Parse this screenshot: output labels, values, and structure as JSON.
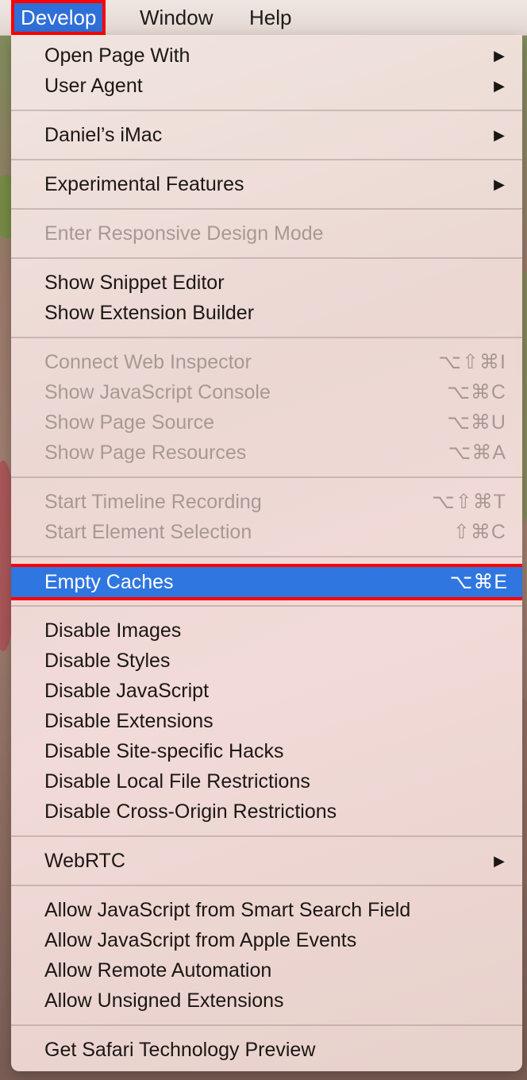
{
  "menubar": {
    "items": [
      {
        "label": "Develop",
        "active": true
      },
      {
        "label": "Window",
        "active": false
      },
      {
        "label": "Help",
        "active": false
      }
    ]
  },
  "menu": {
    "items": [
      {
        "label": "Open Page With",
        "submenu": true
      },
      {
        "label": "User Agent",
        "submenu": true
      },
      {
        "label": "Daniel’s iMac",
        "submenu": true
      },
      {
        "label": "Experimental Features",
        "submenu": true
      },
      {
        "label": "Enter Responsive Design Mode",
        "disabled": true
      },
      {
        "label": "Show Snippet Editor"
      },
      {
        "label": "Show Extension Builder"
      },
      {
        "label": "Connect Web Inspector",
        "shortcut": "⌥⇧⌘I",
        "disabled": true
      },
      {
        "label": "Show JavaScript Console",
        "shortcut": "⌥⌘C",
        "disabled": true
      },
      {
        "label": "Show Page Source",
        "shortcut": "⌥⌘U",
        "disabled": true
      },
      {
        "label": "Show Page Resources",
        "shortcut": "⌥⌘A",
        "disabled": true
      },
      {
        "label": "Start Timeline Recording",
        "shortcut": "⌥⇧⌘T",
        "disabled": true
      },
      {
        "label": "Start Element Selection",
        "shortcut": "⇧⌘C",
        "disabled": true
      },
      {
        "label": "Empty Caches",
        "shortcut": "⌥⌘E",
        "highlighted": true
      },
      {
        "label": "Disable Images"
      },
      {
        "label": "Disable Styles"
      },
      {
        "label": "Disable JavaScript"
      },
      {
        "label": "Disable Extensions"
      },
      {
        "label": "Disable Site-specific Hacks"
      },
      {
        "label": "Disable Local File Restrictions"
      },
      {
        "label": "Disable Cross-Origin Restrictions"
      },
      {
        "label": "WebRTC",
        "submenu": true
      },
      {
        "label": "Allow JavaScript from Smart Search Field"
      },
      {
        "label": "Allow JavaScript from Apple Events"
      },
      {
        "label": "Allow Remote Automation"
      },
      {
        "label": "Allow Unsigned Extensions"
      },
      {
        "label": "Get Safari Technology Preview"
      }
    ],
    "submenu_arrow": "▶"
  },
  "colors": {
    "highlight": "#2f76e0",
    "annotation": "#ff0000",
    "disabled_text": "#a89894"
  }
}
